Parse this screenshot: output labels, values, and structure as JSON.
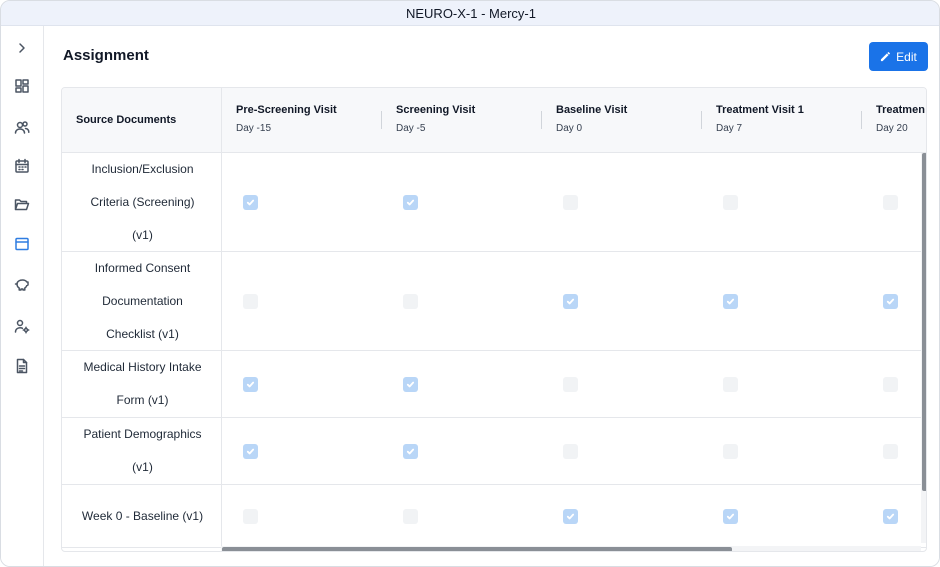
{
  "window": {
    "title": "NEURO-X-1 - Mercy-1"
  },
  "sidebar": {
    "items": [
      {
        "name": "expand",
        "icon": "chevron-right-icon",
        "active": false
      },
      {
        "name": "dashboard",
        "icon": "dashboard-grid-icon",
        "active": false
      },
      {
        "name": "users",
        "icon": "users-icon",
        "active": false
      },
      {
        "name": "calendar",
        "icon": "calendar-icon",
        "active": false
      },
      {
        "name": "folder",
        "icon": "folder-open-icon",
        "active": false
      },
      {
        "name": "assignment",
        "icon": "window-icon",
        "active": true
      },
      {
        "name": "budget",
        "icon": "piggy-bank-icon",
        "active": false
      },
      {
        "name": "user-settings",
        "icon": "user-gear-icon",
        "active": false
      },
      {
        "name": "documents",
        "icon": "document-icon",
        "active": false
      }
    ],
    "active_color": "#2f7de1"
  },
  "header": {
    "page_title": "Assignment",
    "edit_label": "Edit",
    "accent": "#1a73e8"
  },
  "table": {
    "source_header": "Source Documents",
    "visits": [
      {
        "name": "Pre-Screening Visit",
        "day": "Day -15"
      },
      {
        "name": "Screening Visit",
        "day": "Day -5"
      },
      {
        "name": "Baseline Visit",
        "day": "Day 0"
      },
      {
        "name": "Treatment Visit 1",
        "day": "Day 7"
      },
      {
        "name": "Treatmen",
        "day": "Day 20"
      }
    ],
    "rows": [
      {
        "lines": [
          "Inclusion/Exclusion",
          "Criteria (Screening)",
          "(v1)"
        ],
        "checks": [
          true,
          true,
          false,
          false,
          false
        ]
      },
      {
        "lines": [
          "Informed Consent",
          "Documentation",
          "Checklist (v1)"
        ],
        "checks": [
          false,
          false,
          true,
          true,
          true
        ]
      },
      {
        "lines": [
          "Medical History Intake",
          "Form (v1)"
        ],
        "checks": [
          true,
          true,
          false,
          false,
          false
        ]
      },
      {
        "lines": [
          "Patient Demographics",
          "(v1)"
        ],
        "checks": [
          true,
          true,
          false,
          false,
          false
        ]
      },
      {
        "lines": [
          "Week 0 - Baseline (v1)"
        ],
        "checks": [
          false,
          false,
          true,
          true,
          true
        ]
      }
    ],
    "checked_color": "#b9d6f7",
    "unchecked_color": "#f1f3f5"
  }
}
